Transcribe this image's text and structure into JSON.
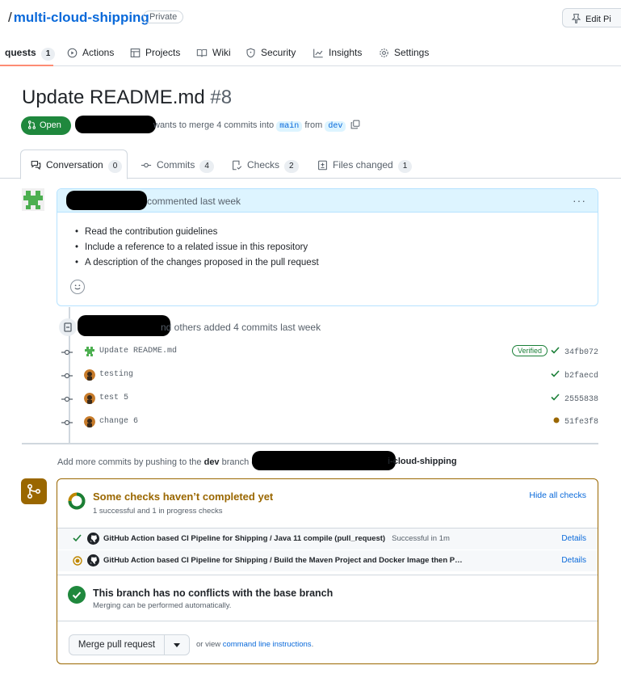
{
  "repo": {
    "name_prefix": "/",
    "name": "multi-cloud-shipping",
    "visibility": "Private",
    "edit_label": "Edit Pi"
  },
  "nav": {
    "items": [
      {
        "label": "quests",
        "count": "1"
      },
      {
        "label": "Actions"
      },
      {
        "label": "Projects"
      },
      {
        "label": "Wiki"
      },
      {
        "label": "Security"
      },
      {
        "label": "Insights"
      },
      {
        "label": "Settings"
      }
    ]
  },
  "pr": {
    "title": "Update README.md",
    "number": "#8",
    "state": "Open",
    "merge_text": "wants to merge 4 commits into",
    "base_branch": "main",
    "from_text": "from",
    "head_branch": "dev"
  },
  "tabs": [
    {
      "label": "Conversation",
      "count": "0"
    },
    {
      "label": "Commits",
      "count": "4"
    },
    {
      "label": "Checks",
      "count": "2"
    },
    {
      "label": "Files changed",
      "count": "1"
    }
  ],
  "comment": {
    "header_text": "commented last week",
    "menu": "···",
    "items": [
      "Read the contribution guidelines",
      "Include a reference to a related issue in this repository",
      "A description of the changes proposed in the pull request"
    ]
  },
  "commits_event": {
    "text": "nd others added 4 commits last week"
  },
  "commits": [
    {
      "message": "Update README.md",
      "sha": "34fb072",
      "verified": "Verified",
      "status": "success"
    },
    {
      "message": "testing",
      "sha": "b2faecd",
      "status": "success"
    },
    {
      "message": "test 5",
      "sha": "2555838",
      "status": "success"
    },
    {
      "message": "change 6",
      "sha": "51fe3f8",
      "status": "pending"
    }
  ],
  "add_more": {
    "text": "Add more commits by pushing to the",
    "branch": "dev",
    "branch_suffix": "branch on",
    "repo_tail": "i-cloud-shipping"
  },
  "merge_box": {
    "checks_title": "Some checks haven’t completed yet",
    "checks_sub": "1 successful and 1 in progress checks",
    "hide_label": "Hide all checks",
    "checks": [
      {
        "name": "GitHub Action based CI Pipeline for Shipping / Java 11 compile (pull_request)",
        "result": "Successful in 1m",
        "details": "Details",
        "status": "success"
      },
      {
        "name": "GitHub Action based CI Pipeline for Shipping / Build the Maven Project and Docker Image then P…",
        "result": "",
        "details": "Details",
        "status": "pending"
      }
    ],
    "conflict_title": "This branch has no conflicts with the base branch",
    "conflict_sub": "Merging can be performed automatically.",
    "merge_label": "Merge pull request",
    "or_view": "or view",
    "cli_link": "command line instructions",
    "cli_suffix": "."
  },
  "colors": {
    "accent": "#0969da",
    "open": "#1f883d",
    "pending": "#9a6700",
    "active_tab": "#fd8c73"
  }
}
